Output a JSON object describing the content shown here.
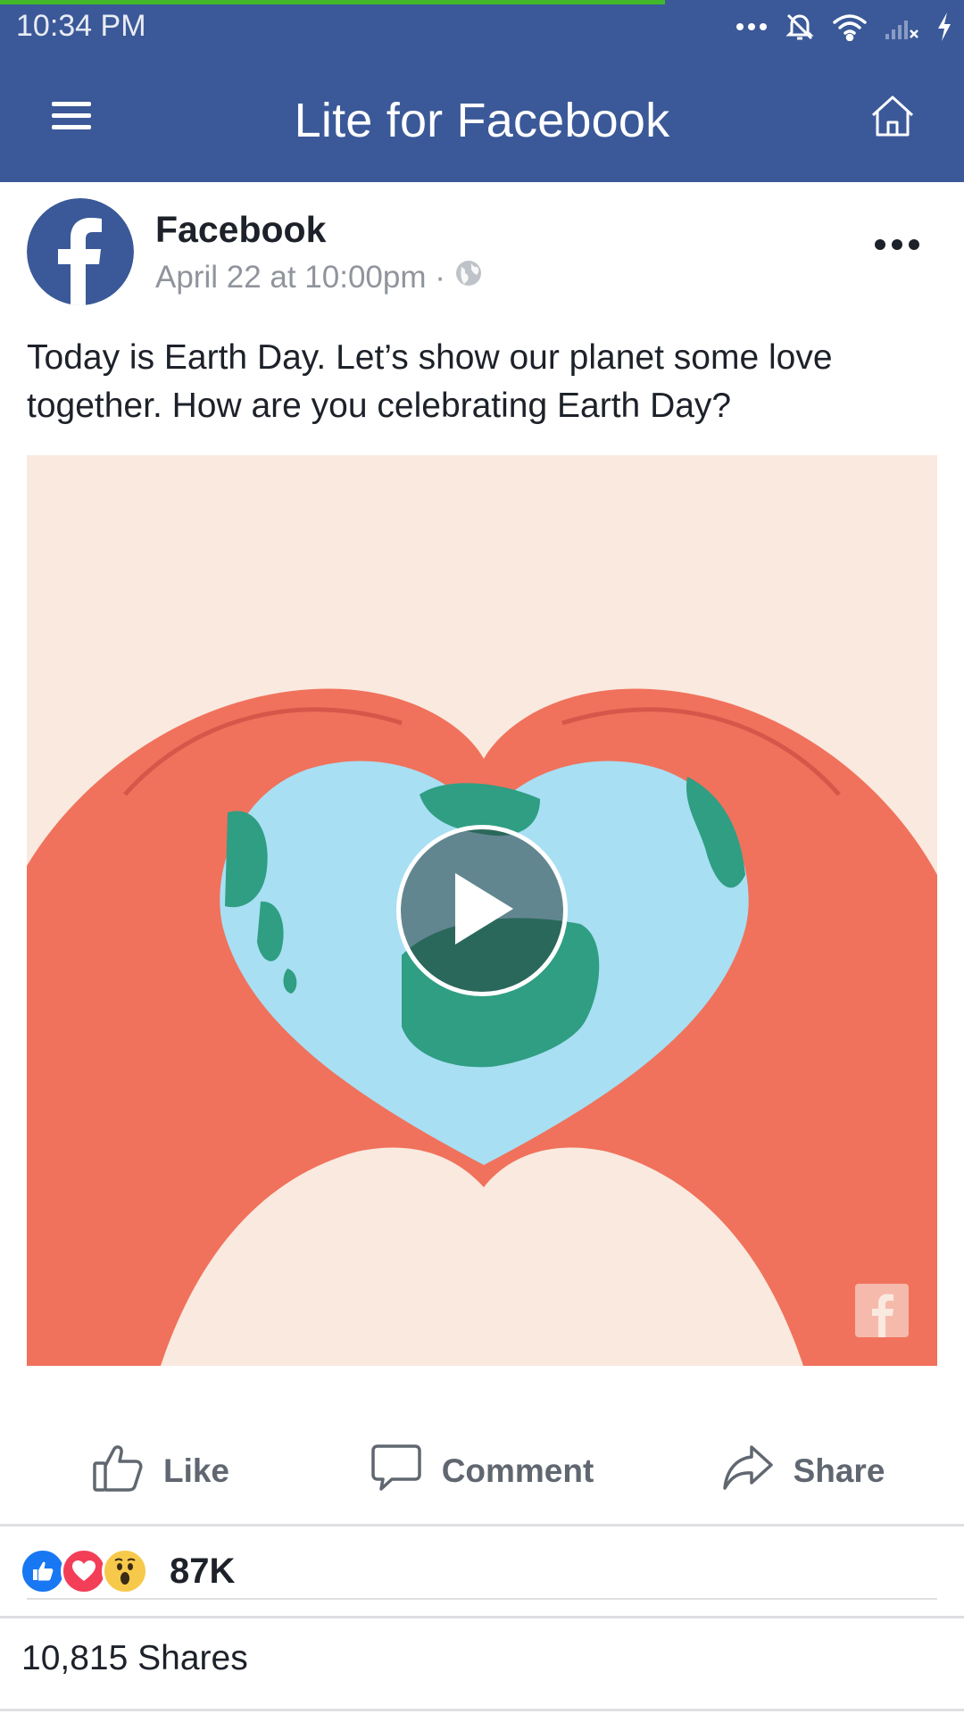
{
  "status_bar": {
    "time": "10:34 PM",
    "colors": {
      "background": "#3b5998",
      "progress": "#42b72a"
    },
    "icons": [
      "more-dots-icon",
      "alarm-off-icon",
      "wifi-icon",
      "signal-no-service-icon",
      "charging-icon"
    ]
  },
  "app_bar": {
    "title": "Lite for Facebook",
    "icons": {
      "left": "menu-icon",
      "right": "home-icon"
    },
    "colors": {
      "background": "#3b5998",
      "text": "#ffffff"
    }
  },
  "post": {
    "author": "Facebook",
    "timestamp": "April 22 at 10:00pm ·",
    "audience_icon": "globe-icon",
    "text": "Today is Earth Day. Let’s show our planet some love together. How are you celebrating Earth Day?",
    "media": {
      "type": "video",
      "icons": [
        "play-icon",
        "facebook-watermark-icon"
      ],
      "colors": {
        "background": "#fae9df",
        "hands": "#f0725c",
        "ocean": "#a8dff3",
        "land": "#2f9e83"
      }
    },
    "actions": [
      {
        "label": "Like",
        "icon": "thumbs-up-icon"
      },
      {
        "label": "Comment",
        "icon": "comment-icon"
      },
      {
        "label": "Share",
        "icon": "share-icon"
      }
    ],
    "reactions": {
      "types": [
        "like",
        "love",
        "wow"
      ],
      "colors": {
        "like": "#1877f2",
        "love": "#f33e58",
        "wow": "#f7c94b"
      },
      "count": "87K"
    },
    "shares": "10,815 Shares"
  }
}
